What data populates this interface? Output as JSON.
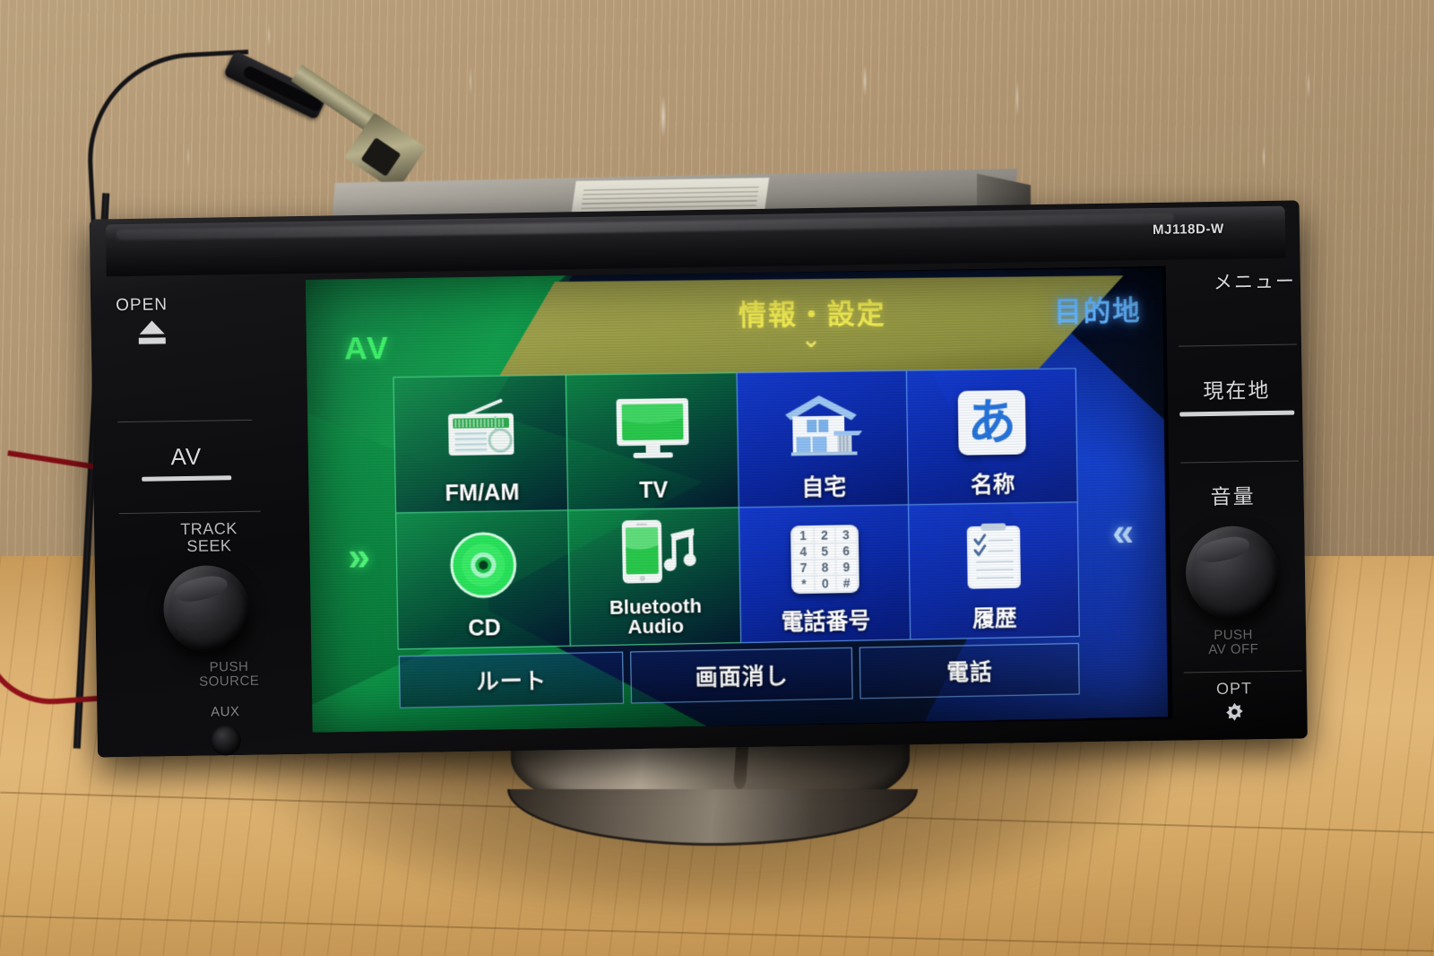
{
  "device": {
    "model": "MJ118D-W",
    "type": "car-navigation-head-unit"
  },
  "left_controls": {
    "open_label": "OPEN",
    "eject_icon": "eject-icon",
    "av_label": "AV",
    "track_seek_label_line1": "TRACK",
    "track_seek_label_line2": "SEEK",
    "knob_label_line1": "PUSH",
    "knob_label_line2": "SOURCE",
    "aux_label": "AUX"
  },
  "right_controls": {
    "menu_label": "メニュー",
    "current_location_label": "現在地",
    "volume_label": "音量",
    "knob_label_line1": "PUSH",
    "knob_label_line2": "AV OFF",
    "opt_label": "OPT",
    "opt_icon": "gear-icon"
  },
  "screen": {
    "header": {
      "title": "情報・設定",
      "chevron": "⌄",
      "chevron_icon": "chevron-down-icon"
    },
    "destination_label": "目的地",
    "av_label": "AV",
    "left_arrow_glyph": "»",
    "right_arrow_glyph": "«",
    "tiles": [
      {
        "label": "FM/AM",
        "label2": "",
        "icon": "radio-icon",
        "group": "green"
      },
      {
        "label": "TV",
        "label2": "",
        "icon": "television-icon",
        "group": "green"
      },
      {
        "label": "自宅",
        "label2": "",
        "icon": "house-icon",
        "group": "blue"
      },
      {
        "label": "名称",
        "label2": "",
        "icon": "hiragana-a-icon",
        "group": "blue"
      },
      {
        "label": "CD",
        "label2": "",
        "icon": "compact-disc-icon",
        "group": "green"
      },
      {
        "label": "Bluetooth",
        "label2": "Audio",
        "icon": "phone-music-icon",
        "group": "green"
      },
      {
        "label": "電話番号",
        "label2": "",
        "icon": "keypad-icon",
        "group": "blue"
      },
      {
        "label": "履歴",
        "label2": "",
        "icon": "clipboard-icon",
        "group": "blue"
      }
    ],
    "bottom_buttons": [
      {
        "label": "ルート"
      },
      {
        "label": "画面消し"
      },
      {
        "label": "電話"
      }
    ],
    "keypad_keys": [
      "1",
      "2",
      "3",
      "4",
      "5",
      "6",
      "7",
      "8",
      "9",
      "*",
      "0",
      "#"
    ],
    "hiragana_char": "あ",
    "colors": {
      "header_band": "#a7a855",
      "header_text": "#f5ef5a",
      "destination_text": "#67b8ff",
      "av_text": "#3ff06a",
      "tile_green": "#148c4b",
      "tile_blue": "#183ecd",
      "tile_border": "#8ce6ff"
    }
  }
}
